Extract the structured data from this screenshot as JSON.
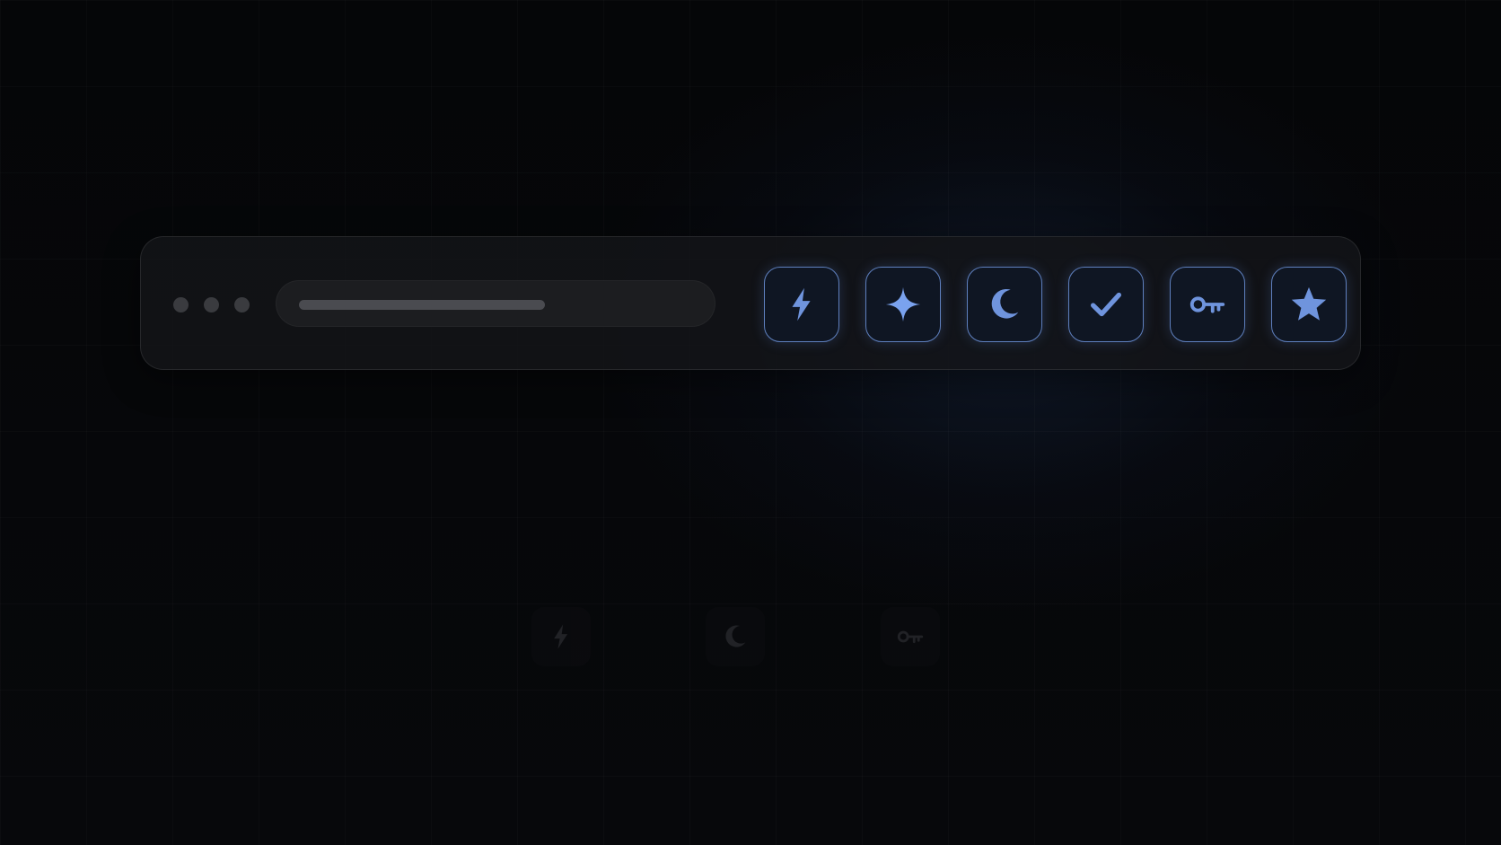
{
  "window": {
    "dots": [
      "dot-1",
      "dot-2",
      "dot-3"
    ],
    "address_bar": {
      "fill_fraction": 0.56
    }
  },
  "toolbar": {
    "buttons": [
      {
        "icon": "lightning-icon"
      },
      {
        "icon": "sparkle-icon"
      },
      {
        "icon": "moon-icon"
      },
      {
        "icon": "check-icon"
      },
      {
        "icon": "key-icon"
      },
      {
        "icon": "star-icon"
      }
    ]
  },
  "ghost_icons": [
    "lightning-icon",
    "moon-icon",
    "key-icon"
  ],
  "colors": {
    "accent": "#6f94dd",
    "accent_border": "#5e7fbd",
    "background": "#050608",
    "toolbar_bg": "#141518",
    "ghost_icon": "#3c3d42"
  }
}
